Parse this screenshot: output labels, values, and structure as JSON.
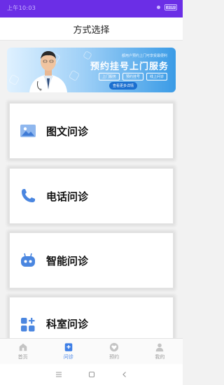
{
  "status_bar": {
    "time": "上午10:03",
    "battery": "100"
  },
  "header": {
    "title": "方式选择"
  },
  "banner": {
    "line": "都用户预约上门可享受最便利",
    "title": "预约挂号上门服务",
    "tags": [
      "上门服务",
      "预约挂号",
      "线上问诊"
    ],
    "button": "查看更多详情"
  },
  "cards": [
    {
      "label": "图文问诊",
      "icon": "image-icon"
    },
    {
      "label": "电话问诊",
      "icon": "phone-icon"
    },
    {
      "label": "智能问诊",
      "icon": "robot-icon"
    },
    {
      "label": "科室问诊",
      "icon": "department-grid-icon"
    }
  ],
  "tabs": [
    {
      "label": "首页",
      "icon": "home-icon",
      "active": false
    },
    {
      "label": "问诊",
      "icon": "consult-icon",
      "active": true
    },
    {
      "label": "预约",
      "icon": "heart-icon",
      "active": false
    },
    {
      "label": "我的",
      "icon": "user-icon",
      "active": false
    }
  ],
  "colors": {
    "status_bar": "#6b2ee6",
    "accent": "#3d7ee6",
    "icon_blue": "#4a86e0"
  }
}
